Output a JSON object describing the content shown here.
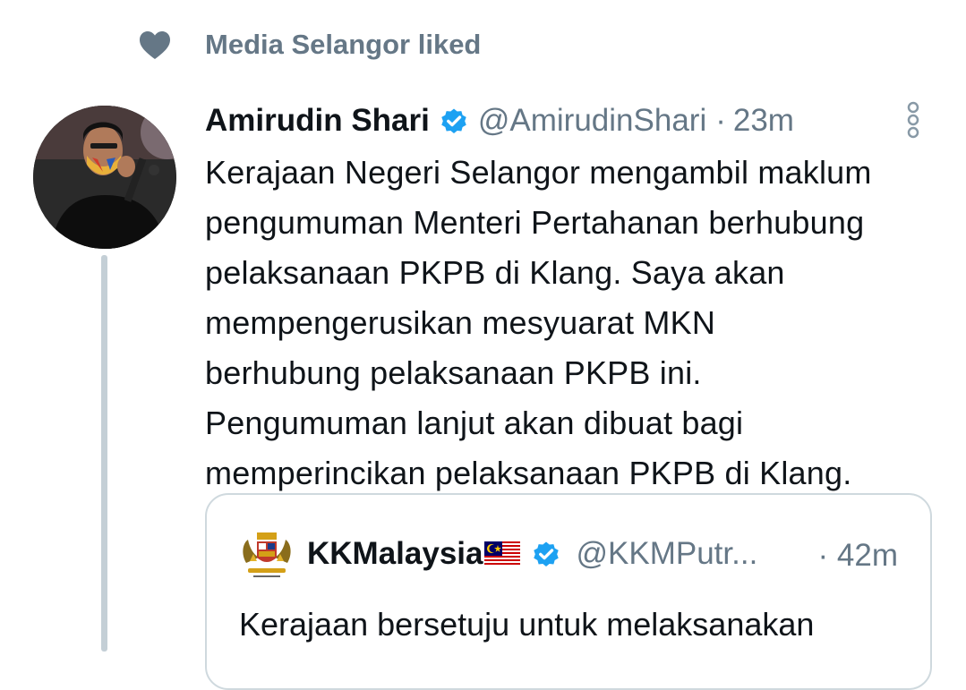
{
  "social_context": {
    "text": "Media Selangor liked",
    "icon": "heart-icon"
  },
  "tweet": {
    "author_name": "Amirudin Shari",
    "handle": "@AmirudinShari",
    "separator": "·",
    "time": "23m",
    "body_lines": [
      "Kerajaan Negeri Selangor mengambil maklum",
      "pengumuman Menteri Pertahanan berhubung",
      "pelaksanaan PKPB di Klang. Saya akan",
      "mempengerusikan mesyuarat MKN",
      "berhubung pelaksanaan PKPB ini.",
      "Pengumuman lanjut akan dibuat bagi",
      "memperincikan pelaksanaan PKPB di Klang."
    ]
  },
  "quoted_tweet": {
    "author_name": "KKMalaysia",
    "handle": "@KKMPutr...",
    "time": "· 42m",
    "text": "Kerajaan bersetuju untuk melaksanakan"
  },
  "colors": {
    "primary_text": "#0f1419",
    "secondary_text": "#657786",
    "verified_blue": "#1da1f2",
    "thread_line": "#c4cfd6",
    "card_border": "#cfd9de"
  }
}
